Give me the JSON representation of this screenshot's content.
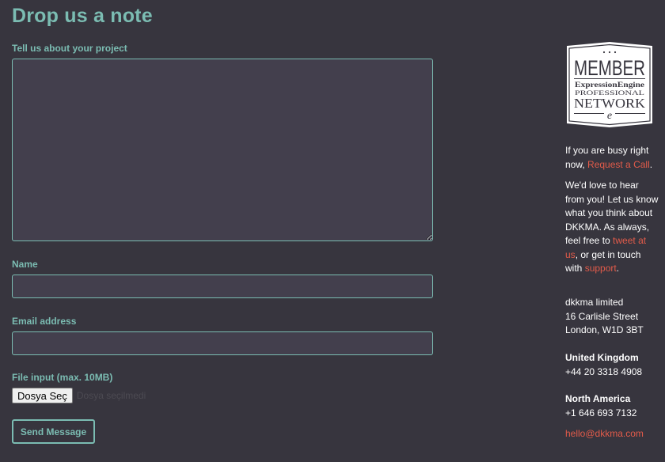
{
  "page_title": "Drop us a note",
  "form": {
    "project_label": "Tell us about your project",
    "project_value": "",
    "name_label": "Name",
    "name_value": "",
    "email_label": "Email address",
    "email_value": "",
    "file_label": "File input (max. 10MB)",
    "file_button": "Dosya Seç",
    "file_status": "Dosya seçilmedi",
    "submit_label": "Send Message"
  },
  "badge": {
    "title": "MEMBER",
    "line1": "ExpressionEngine",
    "line2": "PROFESSIONAL",
    "line3": "NETWORK",
    "logo_letter": "e"
  },
  "sidebar": {
    "busy_text": "If you are busy right now,",
    "request_call_link": "Request a Call",
    "busy_suffix": ".",
    "love_text": "We'd love to hear from you! Let us know what you think about DKKMA. As always, feel free to",
    "tweet_link": "tweet at us",
    "get_in_touch_text": ", or get in touch with",
    "support_link": "support",
    "support_suffix": ".",
    "address": {
      "company": "dkkma limited",
      "street": "16 Carlisle Street",
      "city": "London, W1D 3BT"
    },
    "uk": {
      "heading": "United Kingdom",
      "phone": "+44 20 3318 4908"
    },
    "na": {
      "heading": "North America",
      "phone": "+1 646 693 7132"
    },
    "email": "hello@dkkma.com"
  },
  "colors": {
    "background": "#37353e",
    "accent": "#7bbcb2",
    "field_bg": "#433f4d",
    "link": "#e25b4a"
  }
}
